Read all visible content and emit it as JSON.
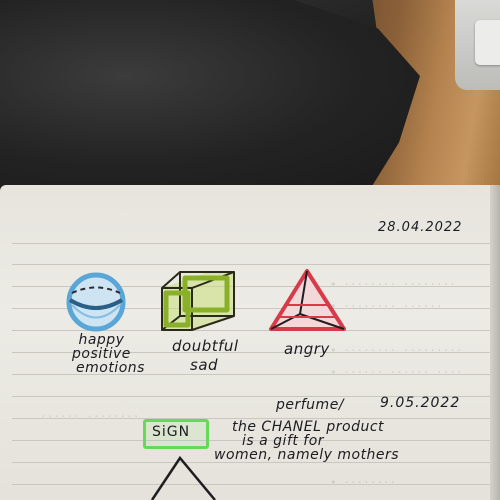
{
  "notebook": {
    "date_top": "28.04.2022",
    "emotions": {
      "happy_lines": [
        "happy",
        "positive",
        "emotions"
      ],
      "doubtful_lines": [
        "doubtful",
        "sad"
      ],
      "angry": "angry"
    },
    "entry2": {
      "perfume": "perfume/",
      "date": "9.05.2022",
      "sign": "SiGN",
      "note_lines": [
        "the CHANEL product",
        "is a gift for",
        "women, namely mothers"
      ]
    }
  },
  "colors": {
    "sphere": "#5aa6d6",
    "cube": "#8ab02a",
    "pyramid": "#d83a4a",
    "sign_box": "#66d85a"
  }
}
